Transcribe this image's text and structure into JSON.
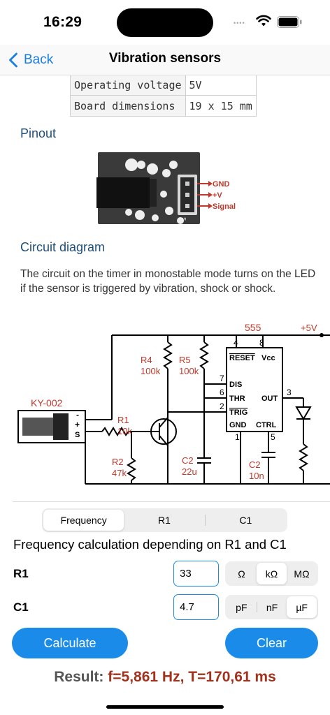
{
  "status_bar": {
    "time": "16:29",
    "dots": "••••"
  },
  "nav": {
    "back_label": "Back",
    "title": "Vibration sensors"
  },
  "spec_table": [
    {
      "key": "Operating voltage",
      "value": "5V"
    },
    {
      "key": "Board dimensions",
      "value": "19 x 15 mm"
    }
  ],
  "pinout": {
    "heading": "Pinout",
    "labels": {
      "gnd": "GND",
      "vcc": "+V",
      "signal": "Signal",
      "s_mark": "S"
    }
  },
  "circuit": {
    "heading": "Circuit diagram",
    "description": "The circuit on the timer in monostable mode turns on the LED if the sensor is triggered by vibration, shock or shock.",
    "labels": {
      "ic": "555",
      "supply": "+5V",
      "sensor": "KY-002",
      "r4": "R4",
      "r4v": "100k",
      "r5": "R5",
      "r5v": "100k",
      "r1": "R1",
      "r1v": "10k",
      "r2": "R2",
      "r2v": "47k",
      "c2": "C2",
      "c2v": "22u",
      "c2b": "C2",
      "c2bv": "10n",
      "pin4": "4",
      "pin8": "8",
      "pin7": "7",
      "pin6": "6",
      "pin2": "2",
      "pin1": "1",
      "pin5": "5",
      "pin3": "3",
      "reset": "RESET",
      "vcc": "Vcc",
      "dis": "DIS",
      "thr": "THR",
      "out": "OUT",
      "trig": "TRIG",
      "gnd": "GND",
      "ctrl": "CTRL",
      "minus": "-",
      "plus": "+",
      "s": "S"
    }
  },
  "calculator": {
    "tabs": [
      "Frequency",
      "R1",
      "C1"
    ],
    "active_tab": 0,
    "title": "Frequency calculation depending on R1 and C1",
    "r1": {
      "label": "R1",
      "value": "33",
      "units": [
        "Ω",
        "kΩ",
        "MΩ"
      ],
      "selected_unit": 1
    },
    "c1": {
      "label": "C1",
      "value": "4.7",
      "units": [
        "pF",
        "nF",
        "µF"
      ],
      "selected_unit": 2
    },
    "calculate_label": "Calculate",
    "clear_label": "Clear",
    "result_label": "Result:",
    "result_value": "f=5,861 Hz, T=170,61 ms"
  },
  "colors": {
    "accent": "#1a8be8",
    "heading": "#1f4e79",
    "result": "#a3321c",
    "diagram_red": "#c0392b"
  }
}
